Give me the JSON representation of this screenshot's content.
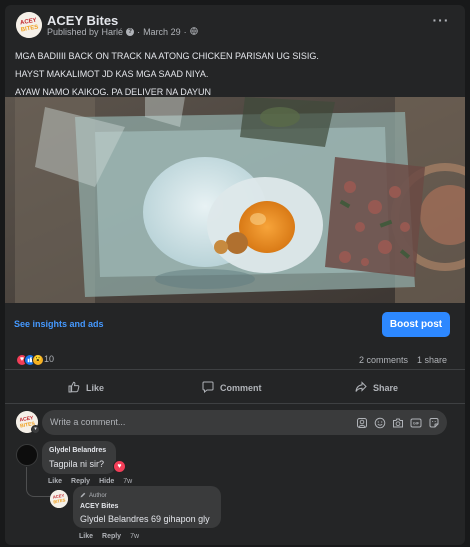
{
  "post": {
    "page_name": "ACEY Bites",
    "published_by_label": "Published by",
    "author": "Harlé",
    "date": "March 29",
    "lines": [
      "MGA BADIIII BACK ON TRACK NA ATONG CHICKEN PARISAN UG SISIG.",
      "HAYST MAKALIMOT JD KAS MGA SAAD NIYA.",
      "AYAW NAMO KAIKOG. PA DELIVER NA DAYUN"
    ]
  },
  "insights": {
    "link": "See insights and ads",
    "boost": "Boost post"
  },
  "stats": {
    "reactions": "10",
    "comments": "2 comments",
    "shares": "1 share"
  },
  "actions": {
    "like": "Like",
    "comment": "Comment",
    "share": "Share"
  },
  "composer": {
    "placeholder": "Write a comment..."
  },
  "comments": [
    {
      "name": "Glydel Belandres",
      "text": "Tagpila ni sir?",
      "like": "Like",
      "reply": "Reply",
      "hide": "Hide",
      "time": "7w"
    }
  ],
  "reply": {
    "badge": "Author",
    "name": "ACEY Bites",
    "text": "Glydel Belandres 69 gihapon gly",
    "like": "Like",
    "reply": "Reply",
    "time": "7w"
  },
  "colors": {
    "accent": "#2d88ff",
    "link": "#4599ff",
    "card": "#242526",
    "bubble": "#3a3b3c"
  },
  "icons": {
    "more": "more-icon",
    "globe": "globe-icon",
    "like": "thumbs-up-icon",
    "comment": "comment-icon",
    "share": "share-icon"
  }
}
